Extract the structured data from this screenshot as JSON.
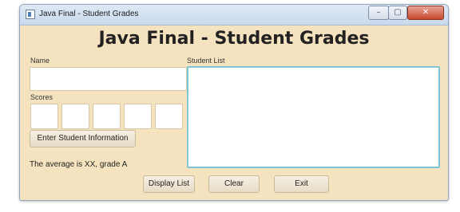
{
  "window": {
    "title": "Java Final - Student Grades",
    "controls": {
      "minimize": "–",
      "maximize": "▢",
      "close": "✕"
    }
  },
  "heading": "Java Final - Student Grades",
  "form": {
    "name_label": "Name",
    "name_value": "",
    "scores_label": "Scores",
    "scores": [
      "",
      "",
      "",
      "",
      ""
    ],
    "enter_button": "Enter Student Information",
    "average_text": "The average is XX, grade A"
  },
  "student_list": {
    "label": "Student List",
    "items": []
  },
  "footer_buttons": {
    "display": "Display List",
    "clear": "Clear",
    "exit": "Exit"
  },
  "colors": {
    "background": "#f5e3bf",
    "list_border": "#7fc6d6",
    "close_button": "#c9482f"
  }
}
